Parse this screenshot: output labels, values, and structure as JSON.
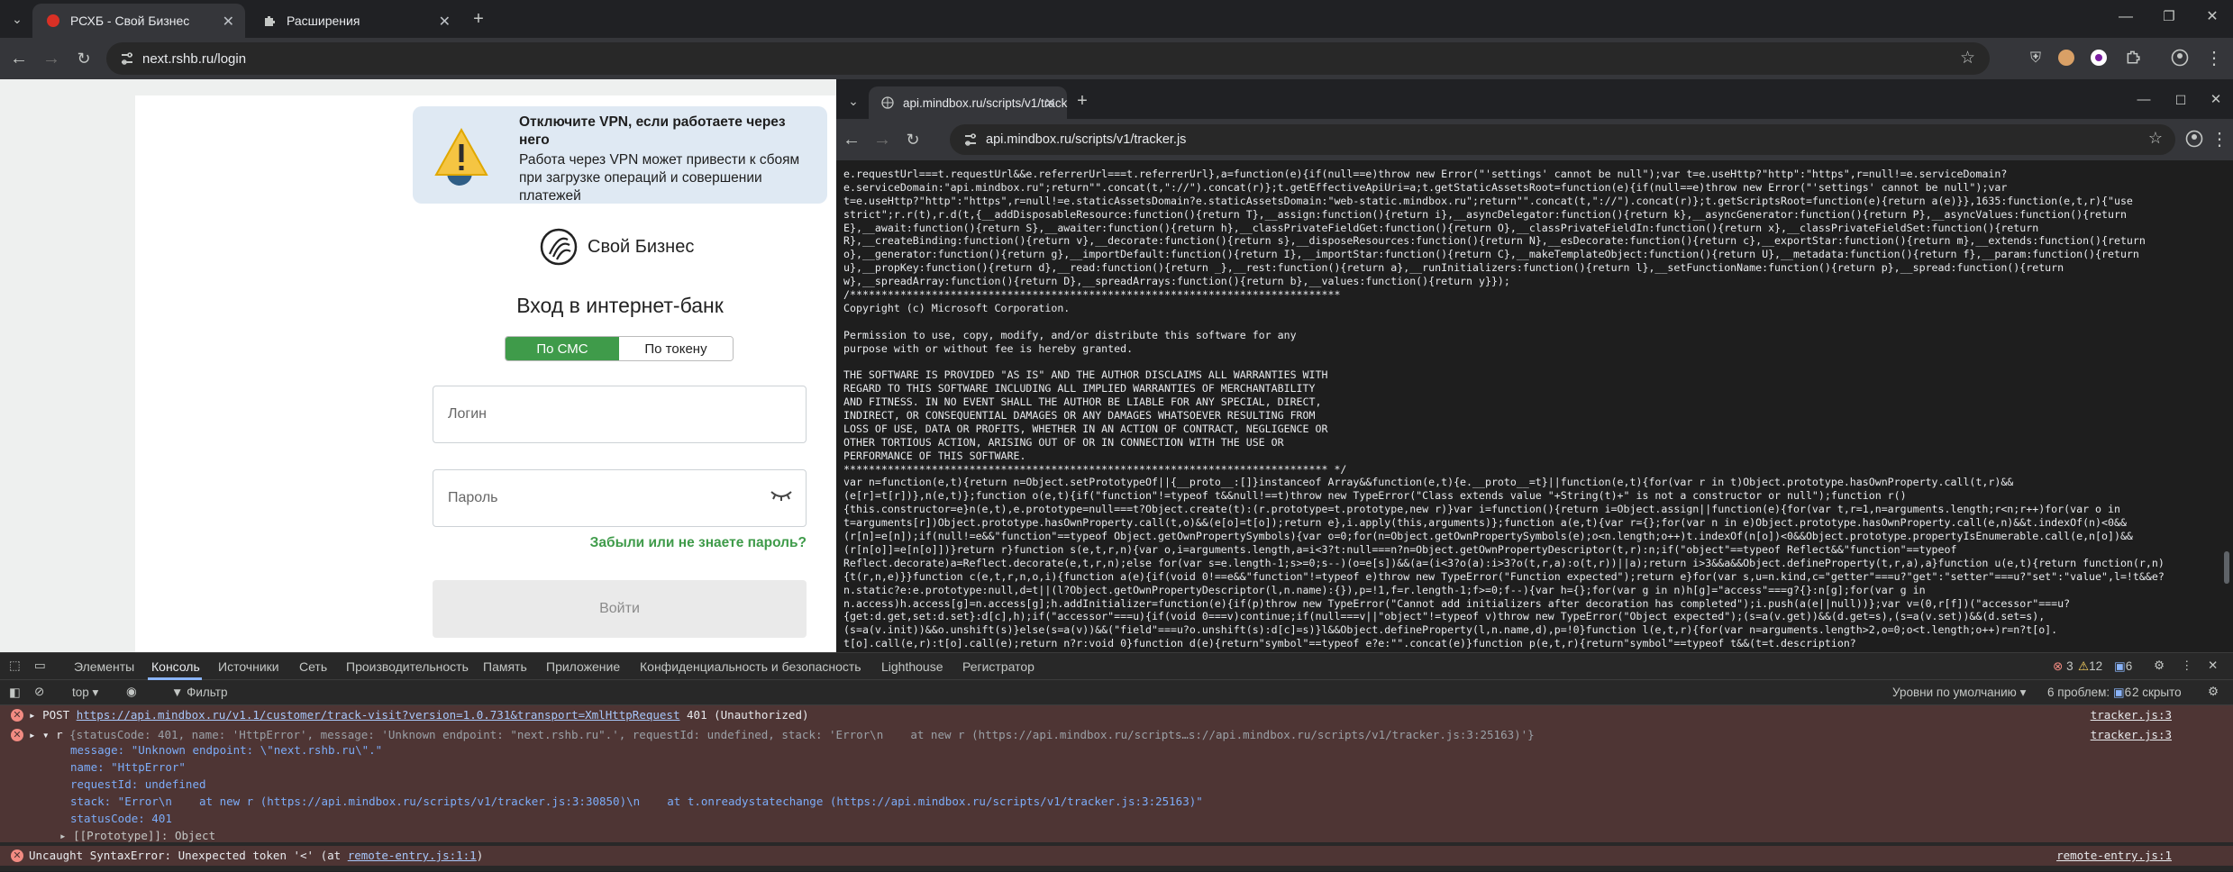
{
  "browser": {
    "tabs": [
      {
        "label": "РСХБ - Свой Бизнес",
        "active": true
      },
      {
        "label": "Расширения",
        "active": false
      }
    ],
    "url": "next.rshb.ru/login"
  },
  "page": {
    "vpn_title": "Отключите VPN, если работаете через него",
    "vpn_text": "Работа через VPN может привести к сбоям при загрузке операций и совершении платежей",
    "brand": "Свой Бизнес",
    "login_title": "Вход в интернет-банк",
    "seg_sms": "По СМС",
    "seg_token": "По токену",
    "login_placeholder": "Логин",
    "password_placeholder": "Пароль",
    "forgot": "Забыли или не знаете пароль?",
    "enter": "Войти"
  },
  "popup": {
    "tab_label": "api.mindbox.ru/scripts/v1/track",
    "url": "api.mindbox.ru/scripts/v1/tracker.js",
    "code_lines": [
      "e.requestUrl===t.requestUrl&&e.referrerUrl===t.referrerUrl},a=function(e){if(null==e)throw new Error(\"'settings' cannot be null\");var t=e.useHttp?\"http\":\"https\",r=null!=e.serviceDomain?",
      "e.serviceDomain:\"api.mindbox.ru\";return\"\".concat(t,\"://\").concat(r)};t.getEffectiveApiUri=a;t.getStaticAssetsRoot=function(e){if(null==e)throw new Error(\"'settings' cannot be null\");var",
      "t=e.useHttp?\"http\":\"https\",r=null!=e.staticAssetsDomain?e.staticAssetsDomain:\"web-static.mindbox.ru\";return\"\".concat(t,\"://\").concat(r)};t.getScriptsRoot=function(e){return a(e)}},1635:function(e,t,r){\"use",
      "strict\";r.r(t),r.d(t,{__addDisposableResource:function(){return T},__assign:function(){return i},__asyncDelegator:function(){return k},__asyncGenerator:function(){return P},__asyncValues:function(){return",
      "E},__await:function(){return S},__awaiter:function(){return h},__classPrivateFieldGet:function(){return O},__classPrivateFieldIn:function(){return x},__classPrivateFieldSet:function(){return",
      "R},__createBinding:function(){return v},__decorate:function(){return s},__disposeResources:function(){return N},__esDecorate:function(){return c},__exportStar:function(){return m},__extends:function(){return",
      "o},__generator:function(){return g},__importDefault:function(){return I},__importStar:function(){return C},__makeTemplateObject:function(){return U},__metadata:function(){return f},__param:function(){return",
      "u},__propKey:function(){return d},__read:function(){return _},__rest:function(){return a},__runInitializers:function(){return l},__setFunctionName:function(){return p},__spread:function(){return",
      "w},__spreadArray:function(){return D},__spreadArrays:function(){return b},__values:function(){return y}});",
      "/******************************************************************************",
      "Copyright (c) Microsoft Corporation.",
      "",
      "Permission to use, copy, modify, and/or distribute this software for any",
      "purpose with or without fee is hereby granted.",
      "",
      "THE SOFTWARE IS PROVIDED \"AS IS\" AND THE AUTHOR DISCLAIMS ALL WARRANTIES WITH",
      "REGARD TO THIS SOFTWARE INCLUDING ALL IMPLIED WARRANTIES OF MERCHANTABILITY",
      "AND FITNESS. IN NO EVENT SHALL THE AUTHOR BE LIABLE FOR ANY SPECIAL, DIRECT,",
      "INDIRECT, OR CONSEQUENTIAL DAMAGES OR ANY DAMAGES WHATSOEVER RESULTING FROM",
      "LOSS OF USE, DATA OR PROFITS, WHETHER IN AN ACTION OF CONTRACT, NEGLIGENCE OR",
      "OTHER TORTIOUS ACTION, ARISING OUT OF OR IN CONNECTION WITH THE USE OR",
      "PERFORMANCE OF THIS SOFTWARE.",
      "***************************************************************************** */",
      "var n=function(e,t){return n=Object.setPrototypeOf||{__proto__:[]}instanceof Array&&function(e,t){e.__proto__=t}||function(e,t){for(var r in t)Object.prototype.hasOwnProperty.call(t,r)&&",
      "(e[r]=t[r])},n(e,t)};function o(e,t){if(\"function\"!=typeof t&&null!==t)throw new TypeError(\"Class extends value \"+String(t)+\" is not a constructor or null\");function r()",
      "{this.constructor=e}n(e,t),e.prototype=null===t?Object.create(t):(r.prototype=t.prototype,new r)}var i=function(){return i=Object.assign||function(e){for(var t,r=1,n=arguments.length;r<n;r++)for(var o in",
      "t=arguments[r])Object.prototype.hasOwnProperty.call(t,o)&&(e[o]=t[o]);return e},i.apply(this,arguments)};function a(e,t){var r={};for(var n in e)Object.prototype.hasOwnProperty.call(e,n)&&t.indexOf(n)<0&&",
      "(r[n]=e[n]);if(null!=e&&\"function\"==typeof Object.getOwnPropertySymbols){var o=0;for(n=Object.getOwnPropertySymbols(e);o<n.length;o++)t.indexOf(n[o])<0&&Object.prototype.propertyIsEnumerable.call(e,n[o])&&",
      "(r[n[o]]=e[n[o]])}return r}function s(e,t,r,n){var o,i=arguments.length,a=i<3?t:null===n?n=Object.getOwnPropertyDescriptor(t,r):n;if(\"object\"==typeof Reflect&&\"function\"==typeof",
      "Reflect.decorate)a=Reflect.decorate(e,t,r,n);else for(var s=e.length-1;s>=0;s--)(o=e[s])&&(a=(i<3?o(a):i>3?o(t,r,a):o(t,r))||a);return i>3&&a&&Object.defineProperty(t,r,a),a}function u(e,t){return function(r,n)",
      "{t(r,n,e)}}function c(e,t,r,n,o,i){function a(e){if(void 0!==e&&\"function\"!=typeof e)throw new TypeError(\"Function expected\");return e}for(var s,u=n.kind,c=\"getter\"===u?\"get\":\"setter\"===u?\"set\":\"value\",l=!t&&e?",
      "n.static?e:e.prototype:null,d=t||(l?Object.getOwnPropertyDescriptor(l,n.name):{}),p=!1,f=r.length-1;f>=0;f--){var h={};for(var g in n)h[g]=\"access\"===g?{}:n[g];for(var g in",
      "n.access)h.access[g]=n.access[g];h.addInitializer=function(e){if(p)throw new TypeError(\"Cannot add initializers after decoration has completed\");i.push(a(e||null))};var v=(0,r[f])(\"accessor\"===u?",
      "{get:d.get,set:d.set}:d[c],h);if(\"accessor\"===u){if(void 0===v)continue;if(null===v||\"object\"!=typeof v)throw new TypeError(\"Object expected\");(s=a(v.get))&&(d.get=s),(s=a(v.set))&&(d.set=s),",
      "(s=a(v.init))&&o.unshift(s)}else(s=a(v))&&(\"field\"===u?o.unshift(s):d[c]=s)}l&&Object.defineProperty(l,n.name,d),p=!0}function l(e,t,r){for(var n=arguments.length>2,o=0;o<t.length;o++)r=n?t[o].",
      "t[o].call(e,r):t[o].call(e);return n?r:void 0}function d(e){return\"symbol\"==typeof e?e:\"\".concat(e)}function p(e,t,r){return\"symbol\"==typeof t&&(t=t.description?"
    ]
  },
  "devtools": {
    "tabs": [
      "Элементы",
      "Консоль",
      "Источники",
      "Сеть",
      "Производительность",
      "Память",
      "Приложение",
      "Конфиденциальность и безопасность",
      "Lighthouse",
      "Регистратор"
    ],
    "context": "top",
    "filter_placeholder": "Фильтр",
    "levels": "Уровни по умолчанию",
    "problems": "6 проблем:",
    "problems_count": "6",
    "hidden": "2 скрыто",
    "badge_errors": "3",
    "badge_warnings": "12",
    "badge_info": "6",
    "console": {
      "line1_method": "POST",
      "line1_url": "https://api.mindbox.ru/v1.1/customer/track-visit?version=1.0.731&transport=XmlHttpRequest",
      "line1_status": "401 (Unauthorized)",
      "line1_src": "tracker.js:3",
      "line2_summary": "{statusCode: 401, name: 'HttpError', message: 'Unknown endpoint: \"next.rshb.ru\".', requestId: undefined, stack: 'Error\\n    at new r (https://api.mindbox.ru/scripts…s://api.mindbox.ru/scripts/v1/tracker.js:3:25163)'}",
      "line2_src": "tracker.js:3",
      "message": "message: \"Unknown endpoint: \\\"next.rshb.ru\\\".\"",
      "name": "name: \"HttpError\"",
      "requestId": "requestId: undefined",
      "stack": "stack: \"Error\\n    at new r (https://api.mindbox.ru/scripts/v1/tracker.js:3:30850)\\n    at t.onreadystatechange (https://api.mindbox.ru/scripts/v1/tracker.js:3:25163)\"",
      "statusCode": "statusCode: 401",
      "prototype": "[[Prototype]]: Object",
      "line3": "Uncaught SyntaxError: Unexpected token '<' (at ",
      "line3_link": "remote-entry.js:1:1",
      "line3_src": "remote-entry.js:1"
    }
  }
}
